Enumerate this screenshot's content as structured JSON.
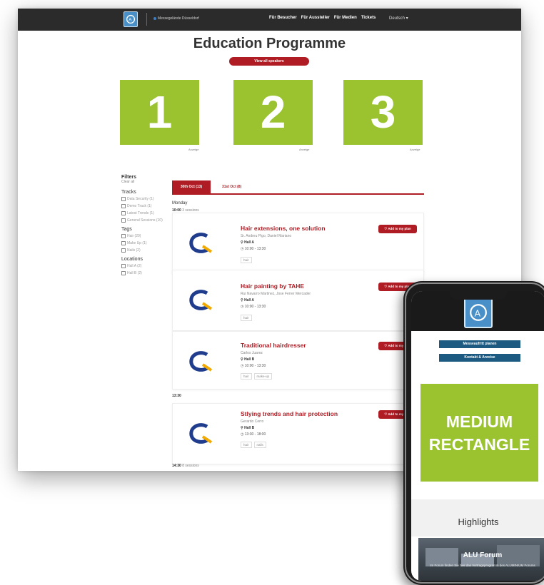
{
  "header": {
    "brand": "Messegelände Düsseldorf",
    "nav": [
      "Für Besucher",
      "Für Aussteller",
      "Für Medien",
      "Tickets"
    ],
    "language": "Deutsch ▾"
  },
  "page": {
    "title": "Education Programme",
    "speakers_button": "View all speakers"
  },
  "ads": [
    {
      "number": "1",
      "label": "Anzeige"
    },
    {
      "number": "2",
      "label": "Anzeige"
    },
    {
      "number": "3",
      "label": "Anzeige"
    }
  ],
  "filters": {
    "title": "Filters",
    "clear": "Clear all",
    "tracks_title": "Tracks",
    "tracks": [
      "Data Security (1)",
      "Demo Track (1)",
      "Latest Trends (1)",
      "General Sessions (10)"
    ],
    "tags_title": "Tags",
    "tags": [
      "Hair (20)",
      "Make Up (1)",
      "Nails (2)"
    ],
    "locations_title": "Locations",
    "locations": [
      "Hall A (2)",
      "Hall B (2)"
    ]
  },
  "tabs": {
    "active": "30th Oct (13)",
    "second": "31st Oct (8)"
  },
  "schedule": {
    "day": "Monday",
    "slot1_time": "10:00",
    "slot1_count": "3 sessions",
    "slot2_time": "13:30",
    "slot3_time": "14:30",
    "slot3_count": "8 sessions"
  },
  "sessions": [
    {
      "title": "Hair extensions, one solution",
      "speakers": "Sr. Andreu Pigo, Daniel Mariano",
      "hall": "Hall A",
      "time": "10:00 - 13:30",
      "tags": [
        "hair"
      ],
      "add": "Add to my plan"
    },
    {
      "title": "Hair painting by TAHE",
      "speakers": "Rui Navarro Martinez, Jose Ferrer Mercader",
      "hall": "Hall A",
      "time": "10:00 - 13:30",
      "tags": [
        "hair"
      ],
      "add": "Add to my plan"
    },
    {
      "title": "Traditional hairdresser",
      "speakers": "Carlos Juarez",
      "hall": "Hall B",
      "time": "10:00 - 13:30",
      "tags": [
        "hair",
        "make-up"
      ],
      "add": "Add to my plan"
    },
    {
      "title": "Stlying trends and hair protection",
      "speakers": "Gerardo Cerro",
      "hall": "Hall B",
      "time": "13:30 - 18:00",
      "tags": [
        "hair",
        "nails"
      ],
      "add": "Add to my plan"
    }
  ],
  "phone": {
    "btn1": "Messeaufritt planen",
    "btn2": "Kontakt & Anreise",
    "ad_line1": "MEDIUM",
    "ad_line2": "RECTANGLE",
    "highlights": "Highlights",
    "card_title": "ALU Forum",
    "card_text": "Im Forum finden Sie hier das Vortragsprogramm des ALUMINIUM Forums"
  },
  "colors": {
    "accent_red": "#b01c24",
    "ad_green": "#9ac32f",
    "topbar": "#2b2b2b",
    "phone_button": "#1d5a82"
  }
}
